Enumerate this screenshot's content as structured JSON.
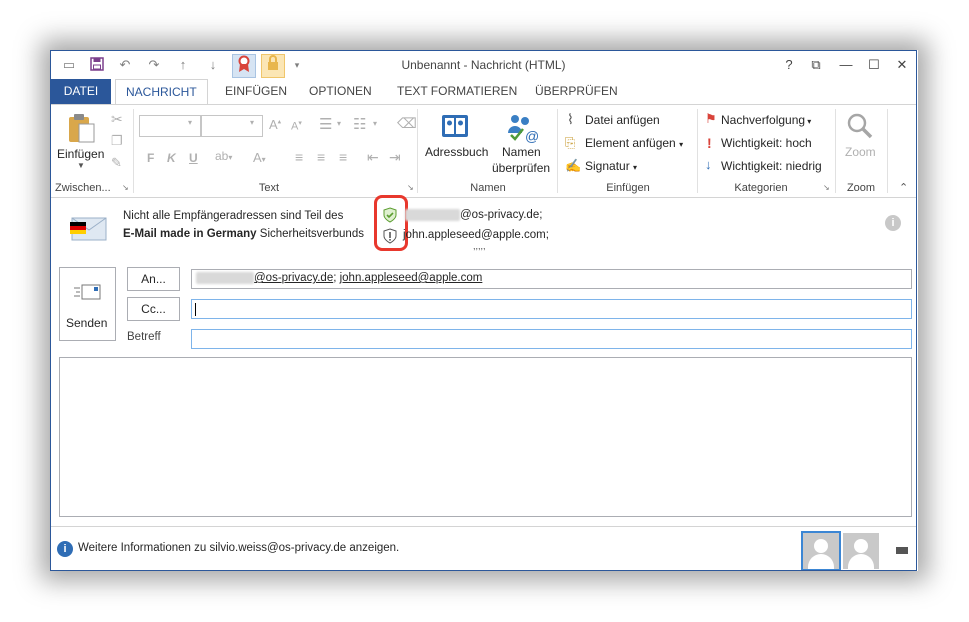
{
  "window": {
    "title": "Unbenannt - Nachricht (HTML)",
    "buttons": {
      "help": "?",
      "restore": "⧉",
      "minimize": "—",
      "maximize": "☐",
      "close": "✕"
    }
  },
  "tabs": [
    "DATEI",
    "NACHRICHT",
    "EINFÜGEN",
    "OPTIONEN",
    "TEXT FORMATIEREN",
    "ÜBERPRÜFEN"
  ],
  "active_tab": "NACHRICHT",
  "ribbon": {
    "clipboard": {
      "paste": "Einfügen",
      "label": "Zwischen..."
    },
    "text": {
      "bold": "F",
      "italic": "K",
      "underline": "U",
      "font_color": "A",
      "label": "Text"
    },
    "names": {
      "address_book": "Adressbuch",
      "check_names_1": "Namen",
      "check_names_2": "überprüfen",
      "label": "Namen"
    },
    "include": {
      "attach_file": "Datei anfügen",
      "attach_item": "Element anfügen",
      "signature": "Signatur",
      "label": "Einfügen"
    },
    "tags": {
      "follow_up": "Nachverfolgung",
      "high": "Wichtigkeit: hoch",
      "low": "Wichtigkeit: niedrig",
      "label": "Kategorien"
    },
    "zoom": {
      "zoom": "Zoom",
      "label": "Zoom"
    }
  },
  "infobar": {
    "line1": "Nicht alle Empfängeradressen sind Teil des",
    "line2_bold": "E-Mail made in Germany",
    "line2_rest": " Sicherheitsverbunds",
    "recipient1_domain": "@os-privacy.de;",
    "recipient2": "john.appleseed@apple.com;",
    "more": ",,,,,"
  },
  "compose": {
    "send": "Senden",
    "to_button": "An...",
    "cc_button": "Cc...",
    "subject_label": "Betreff",
    "to_value_domain": "@os-privacy.de",
    "to_value_sep": "; ",
    "to_value_2": "john.appleseed@apple.com",
    "cc_value": "",
    "subject_value": ""
  },
  "footer": {
    "info": "Weitere Informationen zu silvio.weiss@os-privacy.de anzeigen."
  },
  "colors": {
    "accent": "#2b579a",
    "highlight": "#e8382d",
    "shield_green": "#5c9e31"
  }
}
